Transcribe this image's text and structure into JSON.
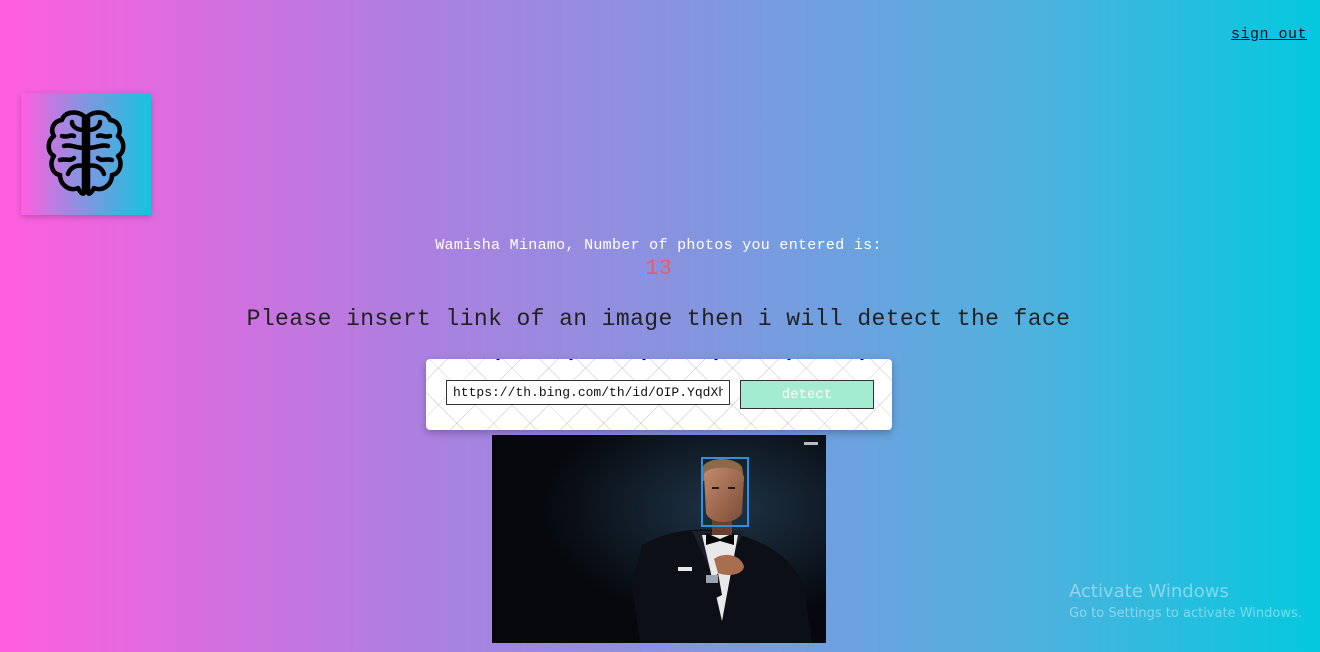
{
  "header": {
    "sign_out_label": "sign out"
  },
  "logo": {
    "icon": "brain-icon"
  },
  "rank": {
    "greeting": "Wamisha Minamo, Number of photos you entered is:",
    "count": "13"
  },
  "instruction": "Please insert link of an image then i will detect the face",
  "form": {
    "url_value": "https://th.bing.com/th/id/OIP.YqdXhHT",
    "button_label": "detect"
  },
  "result": {
    "image_description": "man-in-tuxedo-photo",
    "face_boxes": 1
  },
  "overlay": {
    "title": "Activate Windows",
    "subtitle": "Go to Settings to activate Windows."
  },
  "colors": {
    "count": "#e85d5d",
    "detect_button": "#a3ecd2",
    "face_box": "#2f8fe0"
  }
}
